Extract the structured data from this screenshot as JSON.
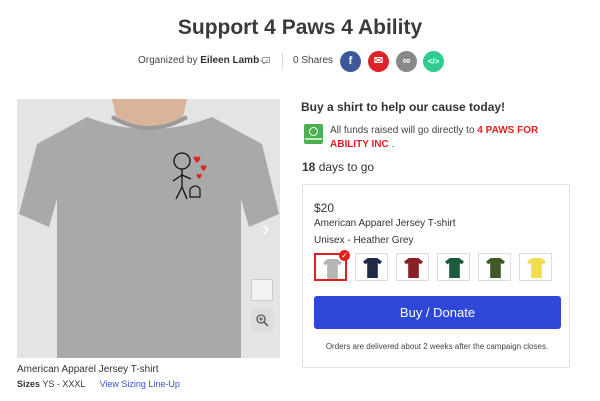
{
  "header": {
    "title": "Support 4 Paws 4 Ability",
    "organized_prefix": "Organized by",
    "organizer": "Eileen Lamb",
    "shares": "0 Shares"
  },
  "social": {
    "facebook": "f",
    "email": "✉",
    "link": "∞",
    "embed": "</>"
  },
  "product": {
    "name": "American Apparel Jersey T-shirt",
    "sizes_label": "Sizes",
    "sizes_value": "YS - XXXL",
    "sizing_link": "View Sizing Line-Up"
  },
  "campaign": {
    "headline": "Buy a shirt to help our cause today!",
    "funds_text": "All funds raised will go directly to",
    "org_name": "4 PAWS FOR ABILITY INC",
    "funds_suffix": ".",
    "days_number": "18",
    "days_text": "days to go"
  },
  "card": {
    "price": "$20",
    "product_name": "American Apparel Jersey T-shirt",
    "variant": "Unisex - Heather Grey",
    "swatches": [
      {
        "name": "Heather Grey",
        "color": "#b5b5b5",
        "selected": true
      },
      {
        "name": "Navy",
        "color": "#1f2b44",
        "selected": false
      },
      {
        "name": "Cranberry",
        "color": "#8a1f26",
        "selected": false
      },
      {
        "name": "Forest",
        "color": "#1d5a3e",
        "selected": false
      },
      {
        "name": "Army",
        "color": "#3f5a26",
        "selected": false
      },
      {
        "name": "Yellow",
        "color": "#f2dd4e",
        "selected": false
      }
    ],
    "buy_label": "Buy / Donate",
    "delivery_note": "Orders are delivered about 2 weeks after the campaign closes."
  },
  "colors": {
    "accent": "#2f47d6",
    "org_red": "#e02020",
    "badge_green": "#4caf50"
  }
}
